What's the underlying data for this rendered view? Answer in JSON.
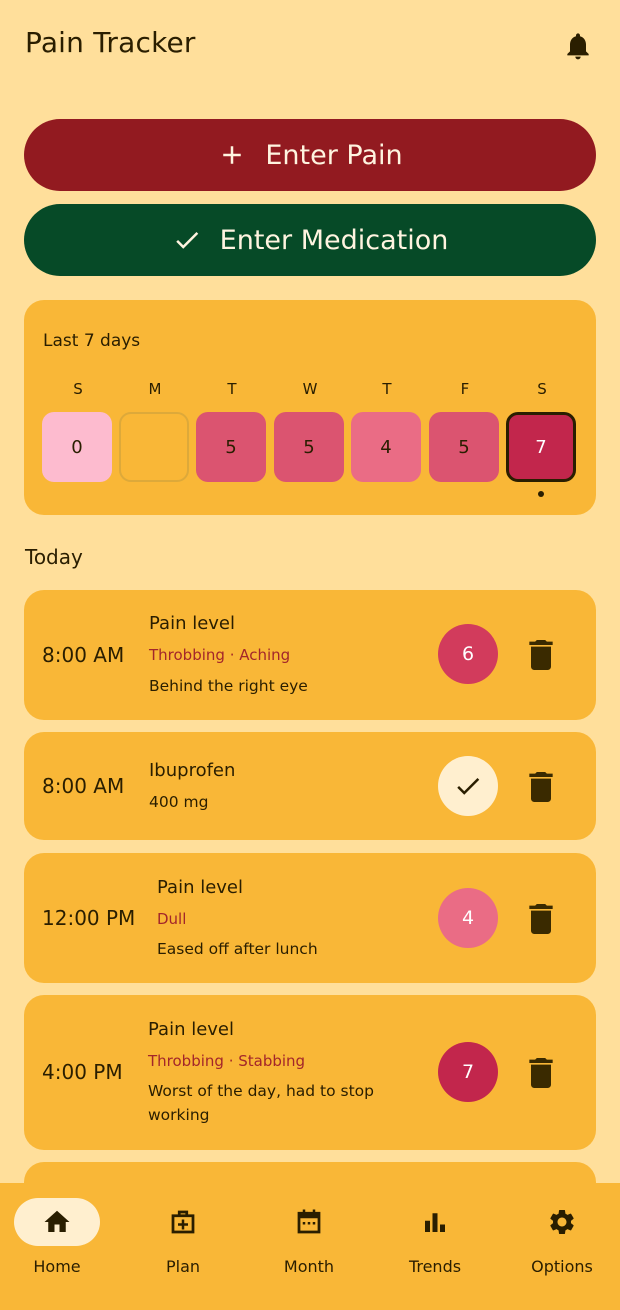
{
  "app": {
    "title": "Pain Tracker",
    "icons": {
      "notifications": "bell-icon"
    }
  },
  "actions": {
    "enter_pain": {
      "label": "Enter Pain",
      "icon": "plus-icon",
      "color": "#921A20"
    },
    "enter_medication": {
      "label": "Enter Medication",
      "icon": "check-icon",
      "color": "#064A27"
    }
  },
  "week": {
    "title": "Last 7 days",
    "days": [
      {
        "letter": "S",
        "value": "0",
        "color": "#FDBBCF"
      },
      {
        "letter": "M",
        "value": "",
        "color": ""
      },
      {
        "letter": "T",
        "value": "5",
        "color": "#DB5470"
      },
      {
        "letter": "W",
        "value": "5",
        "color": "#DB5470"
      },
      {
        "letter": "T",
        "value": "4",
        "color": "#EA6C85"
      },
      {
        "letter": "F",
        "value": "5",
        "color": "#DB5470"
      },
      {
        "letter": "S",
        "value": "7",
        "color": "#C2264C",
        "today": true
      }
    ]
  },
  "today": {
    "title": "Today",
    "entries": [
      {
        "time": "8:00 AM",
        "title": "Pain level",
        "tags": "Throbbing · Aching",
        "note": "Behind the right eye",
        "badge": "6",
        "badge_color": "#D23B5C"
      },
      {
        "time": "8:00 AM",
        "title": "Ibuprofen",
        "note": "400 mg",
        "badge_icon": "check-icon",
        "badge_color": "#FFEFCF"
      },
      {
        "time": "12:00 PM",
        "title": "Pain level",
        "tags": "Dull",
        "note": "Eased off after lunch",
        "badge": "4",
        "badge_color": "#EA6C85"
      },
      {
        "time": "4:00 PM",
        "title": "Pain level",
        "tags": "Throbbing · Stabbing",
        "note": "Worst of the day, had to stop working",
        "badge": "7",
        "badge_color": "#C2264C"
      }
    ]
  },
  "nav": {
    "items": [
      {
        "label": "Home",
        "icon": "home-icon",
        "active": true
      },
      {
        "label": "Plan",
        "icon": "medical-kit-icon"
      },
      {
        "label": "Month",
        "icon": "calendar-icon"
      },
      {
        "label": "Trends",
        "icon": "bar-chart-icon"
      },
      {
        "label": "Options",
        "icon": "gear-icon"
      }
    ]
  },
  "colors": {
    "background": "#FFDF9B",
    "card": "#F9B737",
    "text": "#2A1E00",
    "tag_text": "#A3262A"
  }
}
